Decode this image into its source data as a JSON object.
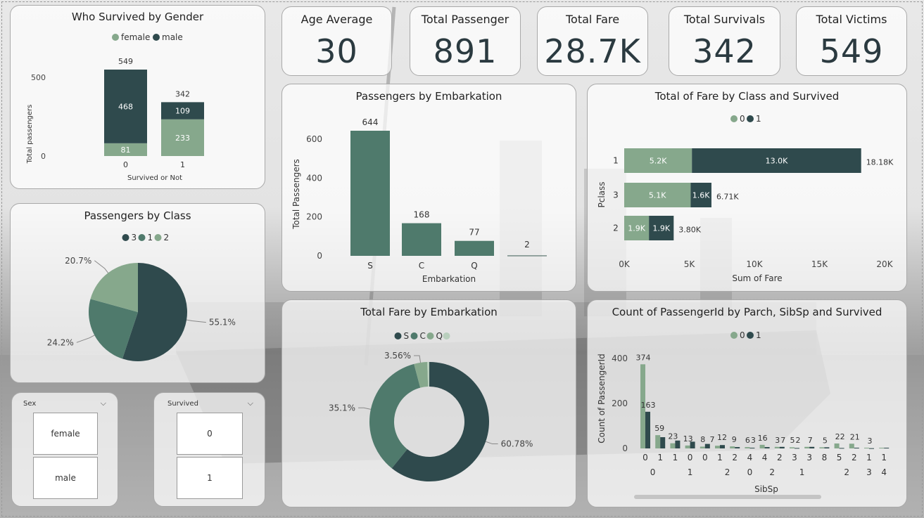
{
  "colors": {
    "dark": "#2f4a4d",
    "mid": "#4f7a6c",
    "light": "#86a88c",
    "lightest": "#b9cfbd"
  },
  "kpis": [
    {
      "title": "Age Average",
      "value": "30"
    },
    {
      "title": "Total Passenger",
      "value": "891"
    },
    {
      "title": "Total Fare",
      "value": "28.7K"
    },
    {
      "title": "Total Survivals",
      "value": "342"
    },
    {
      "title": "Total Victims",
      "value": "549"
    }
  ],
  "slicers": {
    "sex": {
      "label": "Sex",
      "items": [
        "female",
        "male"
      ]
    },
    "survived": {
      "label": "Survived",
      "items": [
        "0",
        "1"
      ]
    }
  },
  "chart_data": [
    {
      "id": "gender",
      "type": "bar",
      "title": "Who Survived by Gender",
      "xlabel": "Survived or Not",
      "ylabel": "Total passengers",
      "categories": [
        "0",
        "1"
      ],
      "series": [
        {
          "name": "female",
          "values": [
            81,
            233
          ]
        },
        {
          "name": "male",
          "values": [
            468,
            109
          ]
        }
      ],
      "totals": [
        549,
        342
      ],
      "yticks": [
        "0",
        "500"
      ],
      "ylim": [
        0,
        549
      ],
      "legend": "top"
    },
    {
      "id": "class_pie",
      "type": "pie",
      "title": "Passengers by Class",
      "legend_labels": [
        "3",
        "1",
        "2"
      ],
      "slices": [
        {
          "name": "3",
          "value": 55.1,
          "label": "55.1%"
        },
        {
          "name": "1",
          "value": 24.2,
          "label": "24.2%"
        },
        {
          "name": "2",
          "value": 20.7,
          "label": "20.7%"
        }
      ],
      "legend": "top"
    },
    {
      "id": "embark_bar",
      "type": "bar",
      "title": "Passengers by Embarkation",
      "xlabel": "Embarkation",
      "ylabel": "Total Passengers",
      "categories": [
        "S",
        "C",
        "Q",
        ""
      ],
      "values": [
        644,
        168,
        77,
        2
      ],
      "value_labels": [
        "644",
        "168",
        "77",
        "2"
      ],
      "yticks": [
        "0",
        "200",
        "400",
        "600"
      ],
      "ylim": [
        0,
        644
      ]
    },
    {
      "id": "fare_class",
      "type": "bar",
      "orientation": "horizontal",
      "title": "Total of Fare by Class and Survived",
      "xlabel": "Sum of Fare",
      "ylabel": "Pclass",
      "categories": [
        "1",
        "3",
        "2"
      ],
      "series": [
        {
          "name": "0",
          "values": [
            5.2,
            5.1,
            1.9
          ],
          "labels": [
            "5.2K",
            "5.1K",
            "1.9K"
          ]
        },
        {
          "name": "1",
          "values": [
            13.0,
            1.6,
            1.9
          ],
          "labels": [
            "13.0K",
            "1.6K",
            "1.9K"
          ]
        }
      ],
      "totals": [
        "18.18K",
        "6.71K",
        "3.80K"
      ],
      "xticks": [
        "0K",
        "5K",
        "10K",
        "15K",
        "20K"
      ],
      "xlim": [
        0,
        20
      ],
      "legend": "top"
    },
    {
      "id": "fare_embark",
      "type": "pie",
      "variant": "donut",
      "title": "Total Fare by Embarkation",
      "legend_labels": [
        "S",
        "C",
        "Q",
        ""
      ],
      "slices": [
        {
          "name": "S",
          "value": 60.78,
          "label": "60.78%"
        },
        {
          "name": "C",
          "value": 35.1,
          "label": "35.1%"
        },
        {
          "name": "Q",
          "value": 3.56,
          "label": "3.56%"
        },
        {
          "name": "",
          "value": 0.56,
          "label": ""
        }
      ],
      "legend": "top"
    },
    {
      "id": "parch_sibsp",
      "type": "bar",
      "title": "Count of PassengerId by Parch, SibSp and Survived",
      "xlabel": "SibSp",
      "ylabel": "Count of PassengerId",
      "inner_categories": [
        "0",
        "1",
        "1",
        "0",
        "0",
        "1",
        "2",
        "4",
        "4",
        "2",
        "3",
        "3",
        "8",
        "5",
        "2",
        "1",
        "1"
      ],
      "outer_categories": [
        {
          "label": "0",
          "span": [
            0,
            1
          ]
        },
        {
          "label": "1",
          "span": [
            2,
            4
          ]
        },
        {
          "label": "2",
          "span": [
            5,
            6
          ]
        },
        {
          "label": "0",
          "span": [
            7,
            7
          ]
        },
        {
          "label": "2",
          "span": [
            8,
            9
          ]
        },
        {
          "label": "1",
          "span": [
            10,
            11
          ]
        },
        {
          "label": "2",
          "span": [
            12,
            15
          ]
        },
        {
          "label": "3",
          "span": [
            15,
            15
          ]
        },
        {
          "label": "4",
          "span": [
            16,
            16
          ]
        }
      ],
      "series": [
        {
          "name": "0",
          "values": [
            374,
            59,
            23,
            13,
            8,
            12,
            9,
            6,
            16,
            7,
            5,
            7,
            5,
            22,
            21,
            3,
            3
          ]
        },
        {
          "name": "1",
          "values": [
            163,
            50,
            35,
            30,
            20,
            15,
            6,
            3,
            6,
            7,
            2,
            7,
            5,
            2,
            3,
            1,
            3
          ]
        }
      ],
      "value_labels": [
        "374",
        "163",
        "59",
        "23",
        "13",
        "8",
        "7",
        "12",
        "9",
        "6",
        "3",
        "16",
        "3",
        "7",
        "5",
        "2",
        "7",
        "5",
        "22",
        "21",
        "3"
      ],
      "yticks": [
        "0",
        "200",
        "400"
      ],
      "ylim": [
        0,
        400
      ],
      "legend": "top"
    }
  ]
}
